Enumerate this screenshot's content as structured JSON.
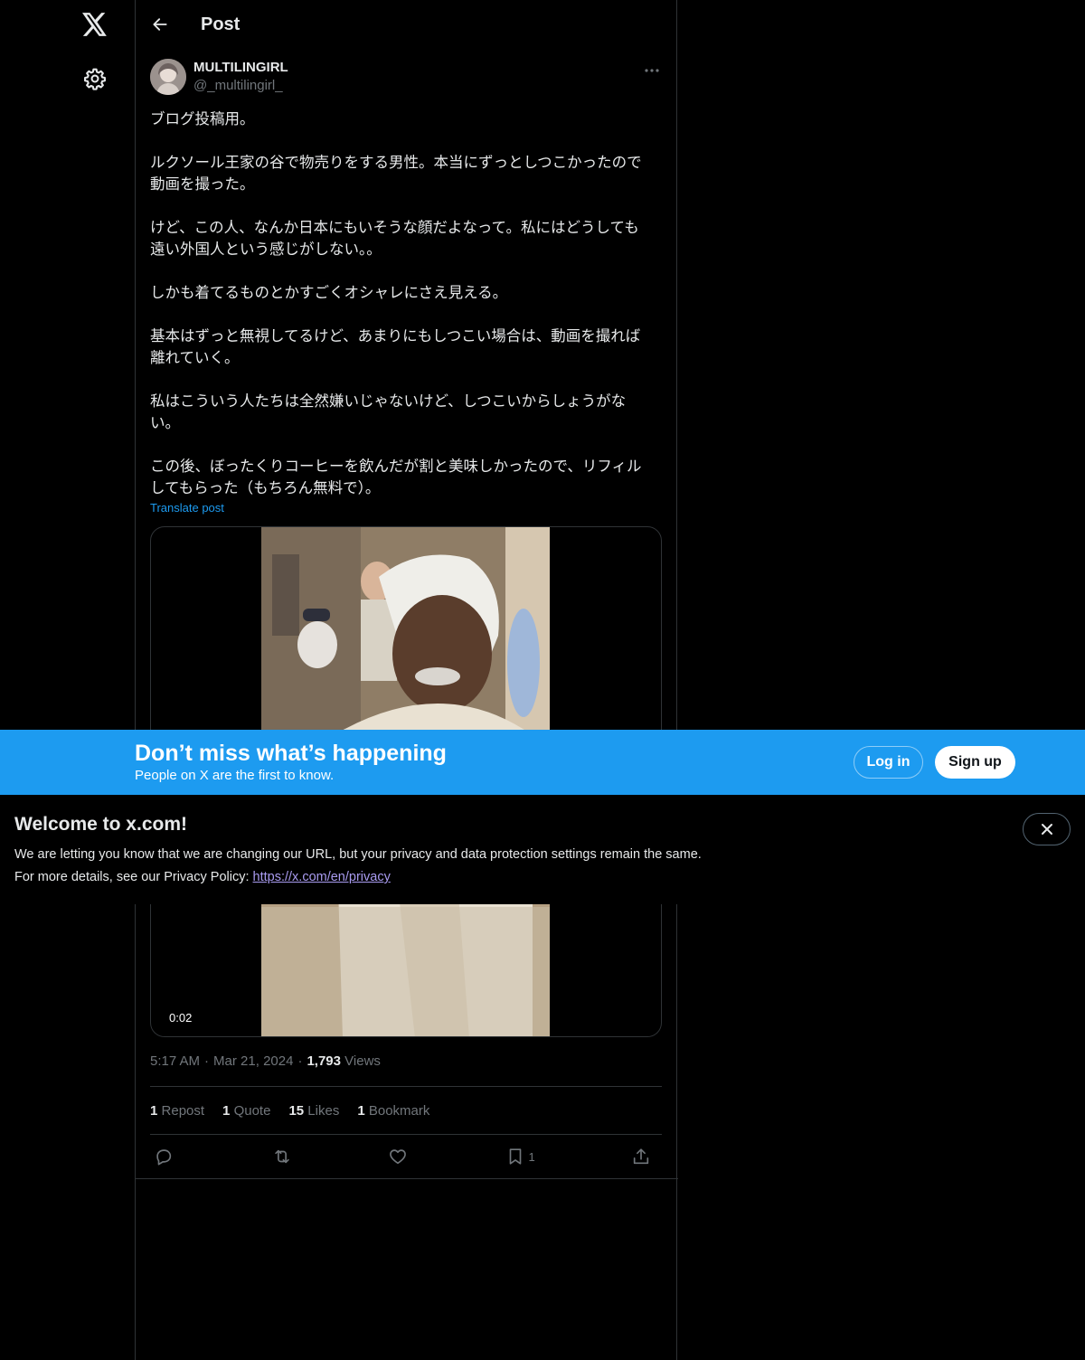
{
  "nav": {
    "logo_icon": "x-logo-icon",
    "settings_icon": "gear-icon"
  },
  "header": {
    "title": "Post",
    "back_icon": "arrow-left-icon"
  },
  "post": {
    "display_name": "MULTILINGIRL",
    "handle": "@_multilingirl_",
    "paragraphs": [
      "ブログ投稿用。",
      "ルクソール王家の谷で物売りをする男性。本当にずっとしつこかったので\n動画を撮った。",
      "けど、この人、なんか日本にもいそうな顔だよなって。私にはどうしても\n遠い外国人という感じがしない。。",
      "しかも着てるものとかすごくオシャレにさえ見える。",
      "基本はずっと無視してるけど、あまりにもしつこい場合は、動画を撮れば\n離れていく。",
      "私はこういう人たちは全然嫌いじゃないけど、しつこいからしょうがな\nい。",
      "この後、ぼったくりコーヒーを飲んだが割と美味しかったので、リフィル\nしてもらった（もちろん無料で）。"
    ],
    "translate_label": "Translate post",
    "video_duration": "0:02",
    "time": "5:17 AM",
    "date": "Mar 21, 2024",
    "views_count": "1,793",
    "views_label": "Views",
    "stats": {
      "reposts_count": "1",
      "reposts_label": "Repost",
      "quotes_count": "1",
      "quotes_label": "Quote",
      "likes_count": "15",
      "likes_label": "Likes",
      "bookmarks_count": "1",
      "bookmarks_label": "Bookmark"
    },
    "actions": {
      "bookmark_count": "1"
    }
  },
  "banner": {
    "title": "Don’t miss what’s happening",
    "subtitle": "People on X are the first to know.",
    "login_label": "Log in",
    "signup_label": "Sign up",
    "color": "#1d9bf0"
  },
  "notice": {
    "title": "Welcome to x.com!",
    "line1": "We are letting you know that we are changing our URL, but your privacy and data protection settings remain the same.",
    "line2_prefix": "For more details, see our Privacy Policy: ",
    "link": "https://x.com/en/privacy"
  }
}
